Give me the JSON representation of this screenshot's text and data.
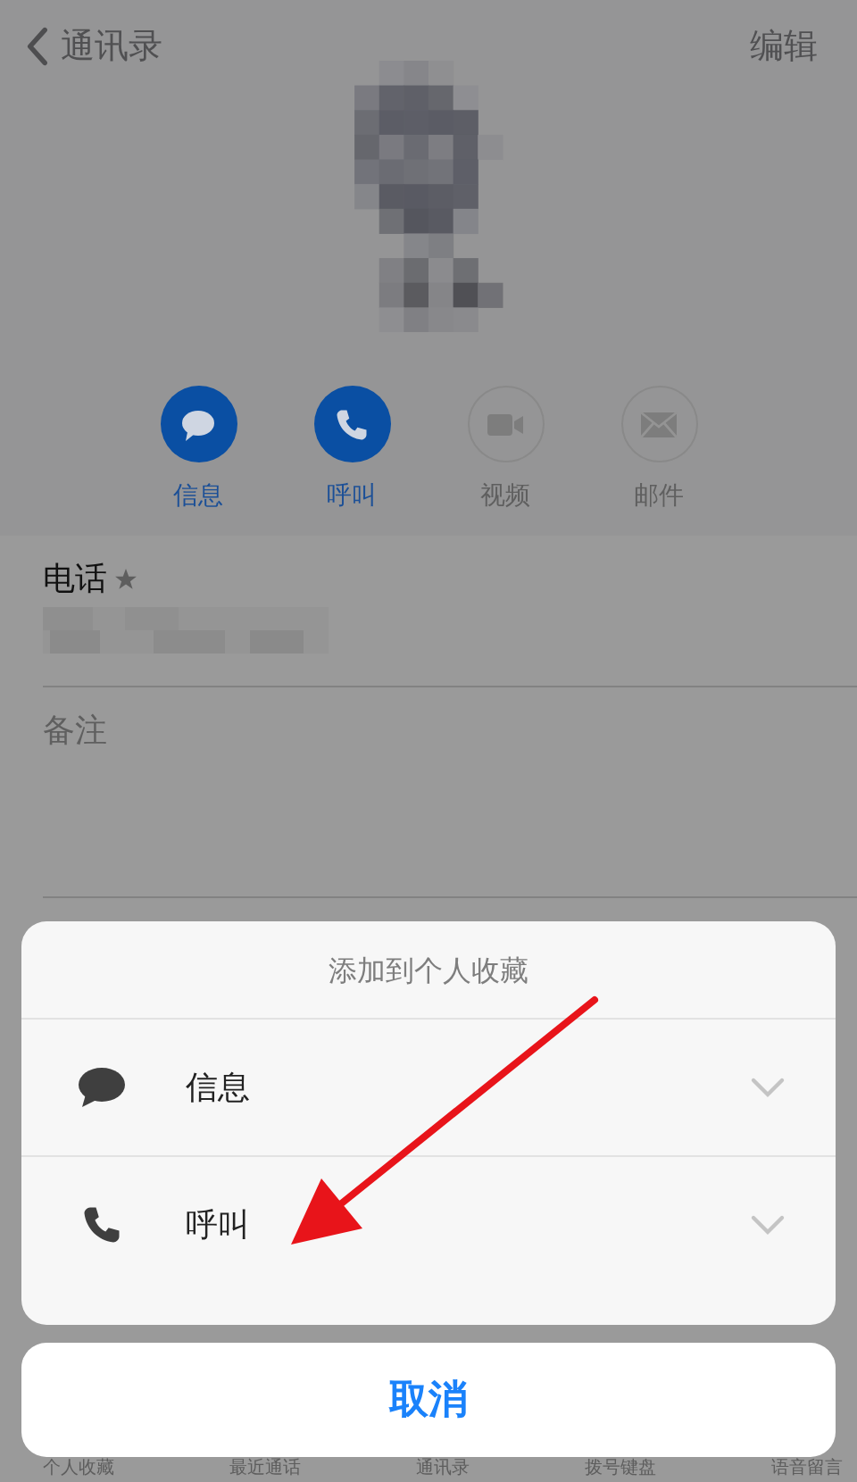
{
  "nav": {
    "back_label": "通讯录",
    "edit_label": "编辑"
  },
  "actions": [
    {
      "kind": "message",
      "label": "信息",
      "enabled": true
    },
    {
      "kind": "call",
      "label": "呼叫",
      "enabled": true
    },
    {
      "kind": "video",
      "label": "视频",
      "enabled": false
    },
    {
      "kind": "mail",
      "label": "邮件",
      "enabled": false
    }
  ],
  "phone": {
    "label": "电话",
    "favorite": true
  },
  "notes": {
    "label": "备注"
  },
  "sheet": {
    "title": "添加到个人收藏",
    "options": [
      {
        "kind": "message",
        "label": "信息"
      },
      {
        "kind": "call",
        "label": "呼叫"
      }
    ],
    "cancel": "取消"
  },
  "tab_bar": [
    "个人收藏",
    "最近通话",
    "通讯录",
    "拨号键盘",
    "语音留言"
  ]
}
